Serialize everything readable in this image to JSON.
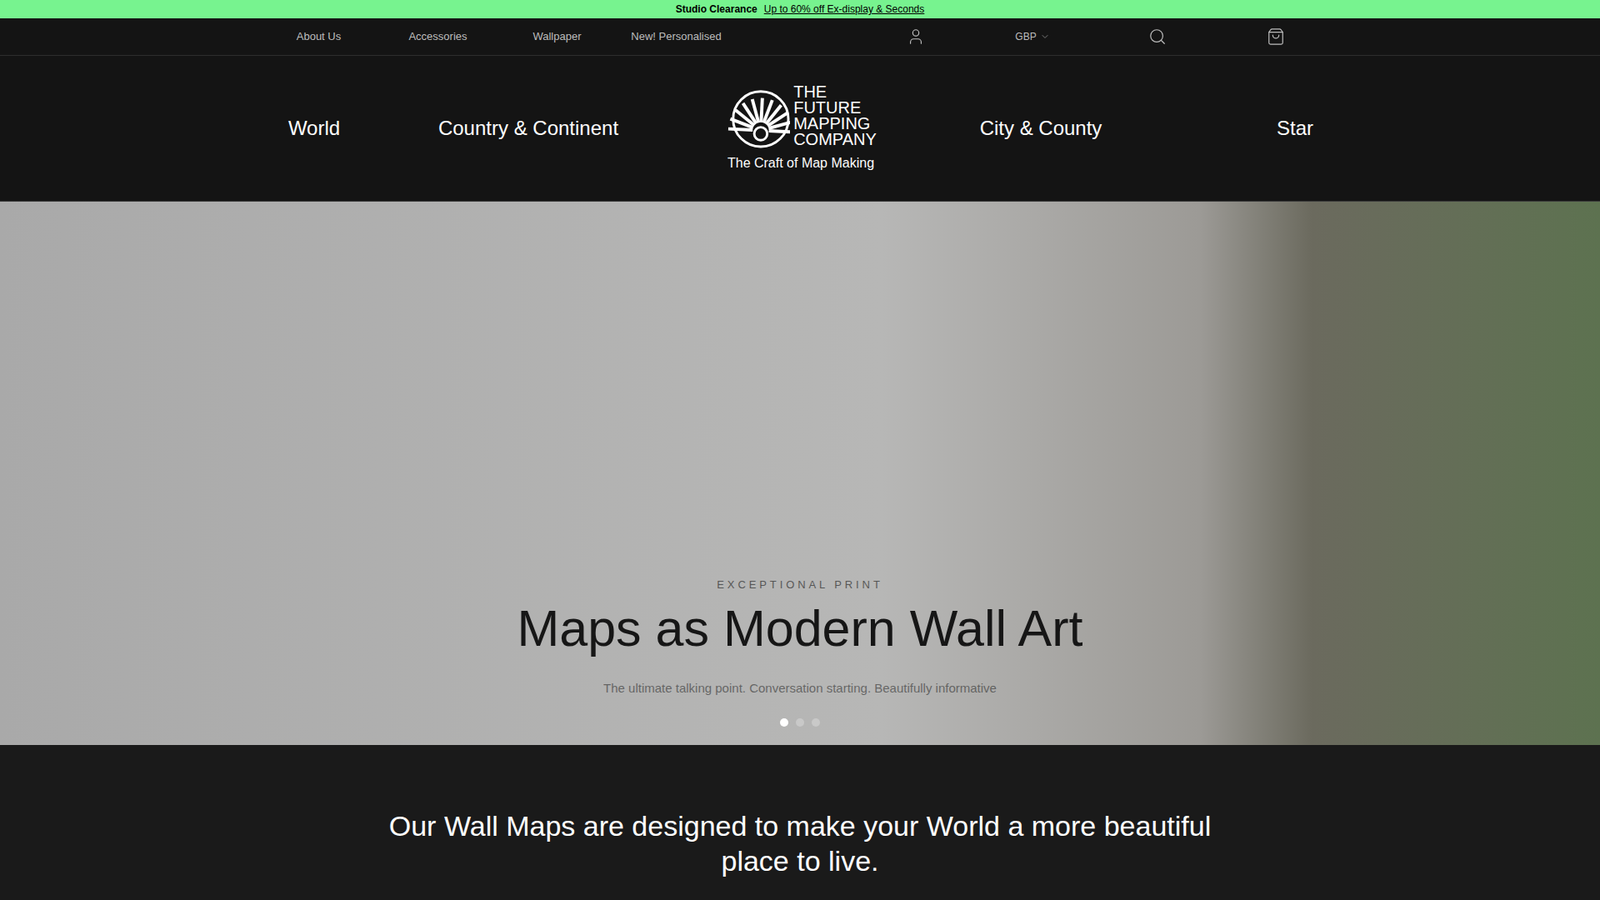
{
  "promo": {
    "title": "Studio Clearance",
    "link": "Up to 60% off Ex-display & Seconds"
  },
  "utility_nav": [
    "About Us",
    "Accessories",
    "Wallpaper",
    "New! Personalised"
  ],
  "currency": "GBP",
  "main_nav_left": [
    "World",
    "Country & Continent"
  ],
  "logo": {
    "lines": [
      "THE",
      "FUTURE",
      "MAPPING",
      "COMPANY"
    ],
    "tagline": "The Craft of Map Making"
  },
  "main_nav_right": [
    "City & County",
    "Star"
  ],
  "hero": {
    "eyebrow": "EXCEPTIONAL PRINT",
    "title": "Maps as Modern Wall Art",
    "subtitle": "The ultimate talking point. Conversation starting. Beautifully informative",
    "slides": [
      {
        "selected": true
      },
      {
        "selected": false
      },
      {
        "selected": false
      }
    ]
  },
  "intro": "Our Wall Maps are designed to make your World a more beautiful place to live."
}
